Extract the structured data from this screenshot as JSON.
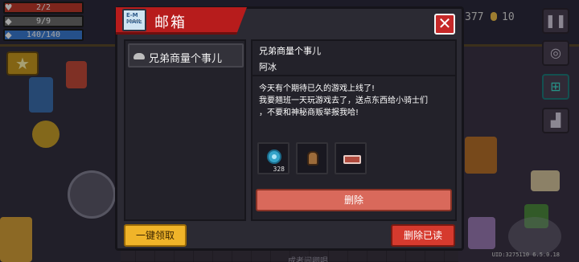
{
  "hud": {
    "hp": "2/2",
    "armor": "9/9",
    "energy": "140/140",
    "coins": "377",
    "gems": "10",
    "uid": "UID:3275110 6.5.0.18"
  },
  "scene": {
    "bottom_text": "成者间卿唱"
  },
  "mailbox": {
    "title": "邮箱",
    "icon_text": "E-M\nMAIL",
    "close_glyph": "✕",
    "mail_list": [
      {
        "label": "兄弟商量个事儿"
      }
    ],
    "detail": {
      "title": "兄弟商量个事儿",
      "sender": "阿冰",
      "body_lines": [
        "今天有个期待已久的游戏上线了!",
        "我要翘班一天玩游戏去了，送点东西给小骑士们",
        "，不要和神秘商贩举报我哈!"
      ],
      "attachments": [
        {
          "icon": "gem-icon",
          "qty": "328"
        },
        {
          "icon": "character-head-icon",
          "qty": ""
        },
        {
          "icon": "ticket-icon",
          "qty": ""
        }
      ],
      "delete_label": "删除"
    },
    "claim_all_label": "一键领取",
    "delete_read_label": "删除已读"
  },
  "colors": {
    "title_bar": "#b71c1c",
    "claim_button": "#f0b429",
    "delete_button": "#d9695b",
    "delete_read_button": "#d63a2e"
  }
}
